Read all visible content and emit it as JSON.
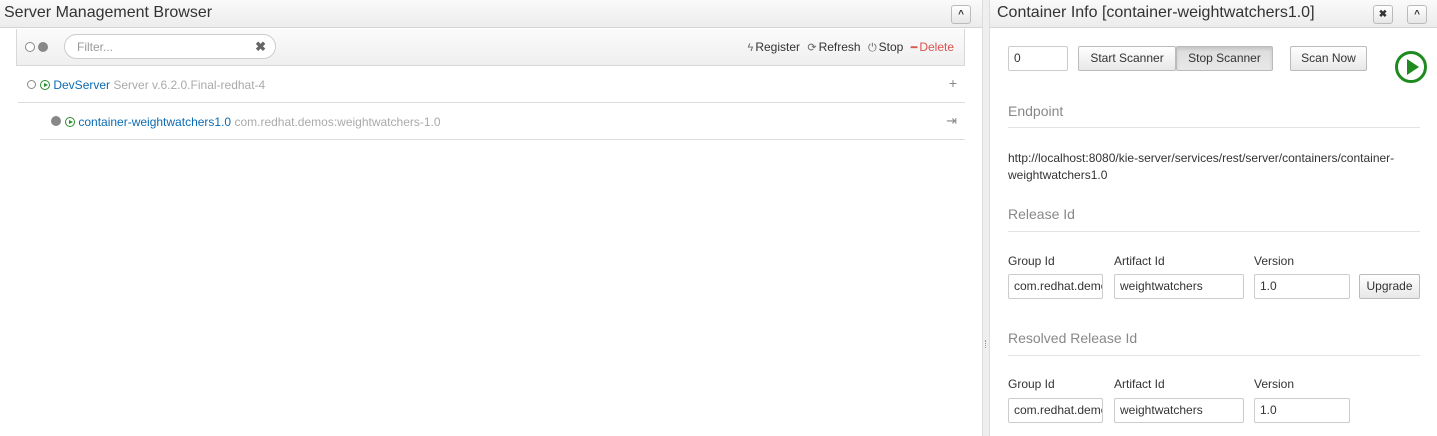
{
  "left_panel": {
    "title": "Server Management Browser",
    "collapse_label": "^",
    "toolbar": {
      "filter_placeholder": "Filter...",
      "clear_label": "✖",
      "register_label": "Register",
      "refresh_label": "Refresh",
      "stop_label": "Stop",
      "delete_label": "Delete"
    },
    "server": {
      "name": "DevServer",
      "version": "Server v.6.2.0.Final-redhat-4",
      "add_label": "+"
    },
    "container": {
      "name": "container-weightwatchers1.0",
      "gav": "com.redhat.demos:weightwatchers-1.0"
    }
  },
  "right_panel": {
    "title": "Container Info [container-weightwatchers1.0]",
    "close_label": "✖",
    "collapse_label": "^",
    "scanner": {
      "interval_value": "0",
      "start_label": "Start Scanner",
      "stop_label": "Stop Scanner",
      "scan_now_label": "Scan Now"
    },
    "endpoint": {
      "heading": "Endpoint",
      "url": "http://localhost:8080/kie-server/services/rest/server/containers/container-weightwatchers1.0"
    },
    "release_id": {
      "heading": "Release Id",
      "group_label": "Group Id",
      "group_value": "com.redhat.demos",
      "artifact_label": "Artifact Id",
      "artifact_value": "weightwatchers",
      "version_label": "Version",
      "version_value": "1.0",
      "upgrade_label": "Upgrade"
    },
    "resolved_release_id": {
      "heading": "Resolved Release Id",
      "group_label": "Group Id",
      "group_value": "com.redhat.demos",
      "artifact_label": "Artifact Id",
      "artifact_value": "weightwatchers",
      "version_label": "Version",
      "version_value": "1.0"
    }
  }
}
